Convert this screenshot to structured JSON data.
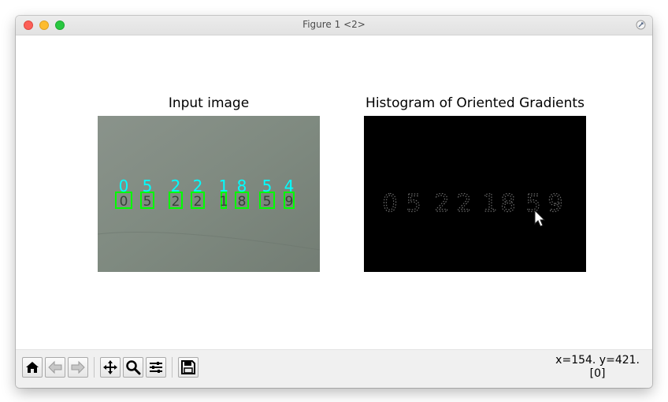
{
  "window": {
    "title": "Figure 1 <2>"
  },
  "figure": {
    "left_title": "Input image",
    "right_title": "Histogram of Oriented Gradients",
    "detected_digits": [
      "0",
      "5",
      "2",
      "2",
      "1",
      "8",
      "5",
      "4"
    ],
    "hog_digits": [
      "0",
      "5",
      "2",
      "2",
      "1",
      "8",
      "5",
      "9"
    ]
  },
  "toolbar": {
    "buttons": [
      "home-icon",
      "back-icon",
      "forward-icon",
      "pan-icon",
      "zoom-icon",
      "configure-subplots-icon",
      "save-icon"
    ],
    "coordinates": "x=154. y=421.",
    "pixel_value": "[0]"
  },
  "colors": {
    "label_cyan": "#00ffff",
    "box_green": "#00ff00",
    "photo_background": "#7f8a80",
    "hog_background": "#000000"
  }
}
